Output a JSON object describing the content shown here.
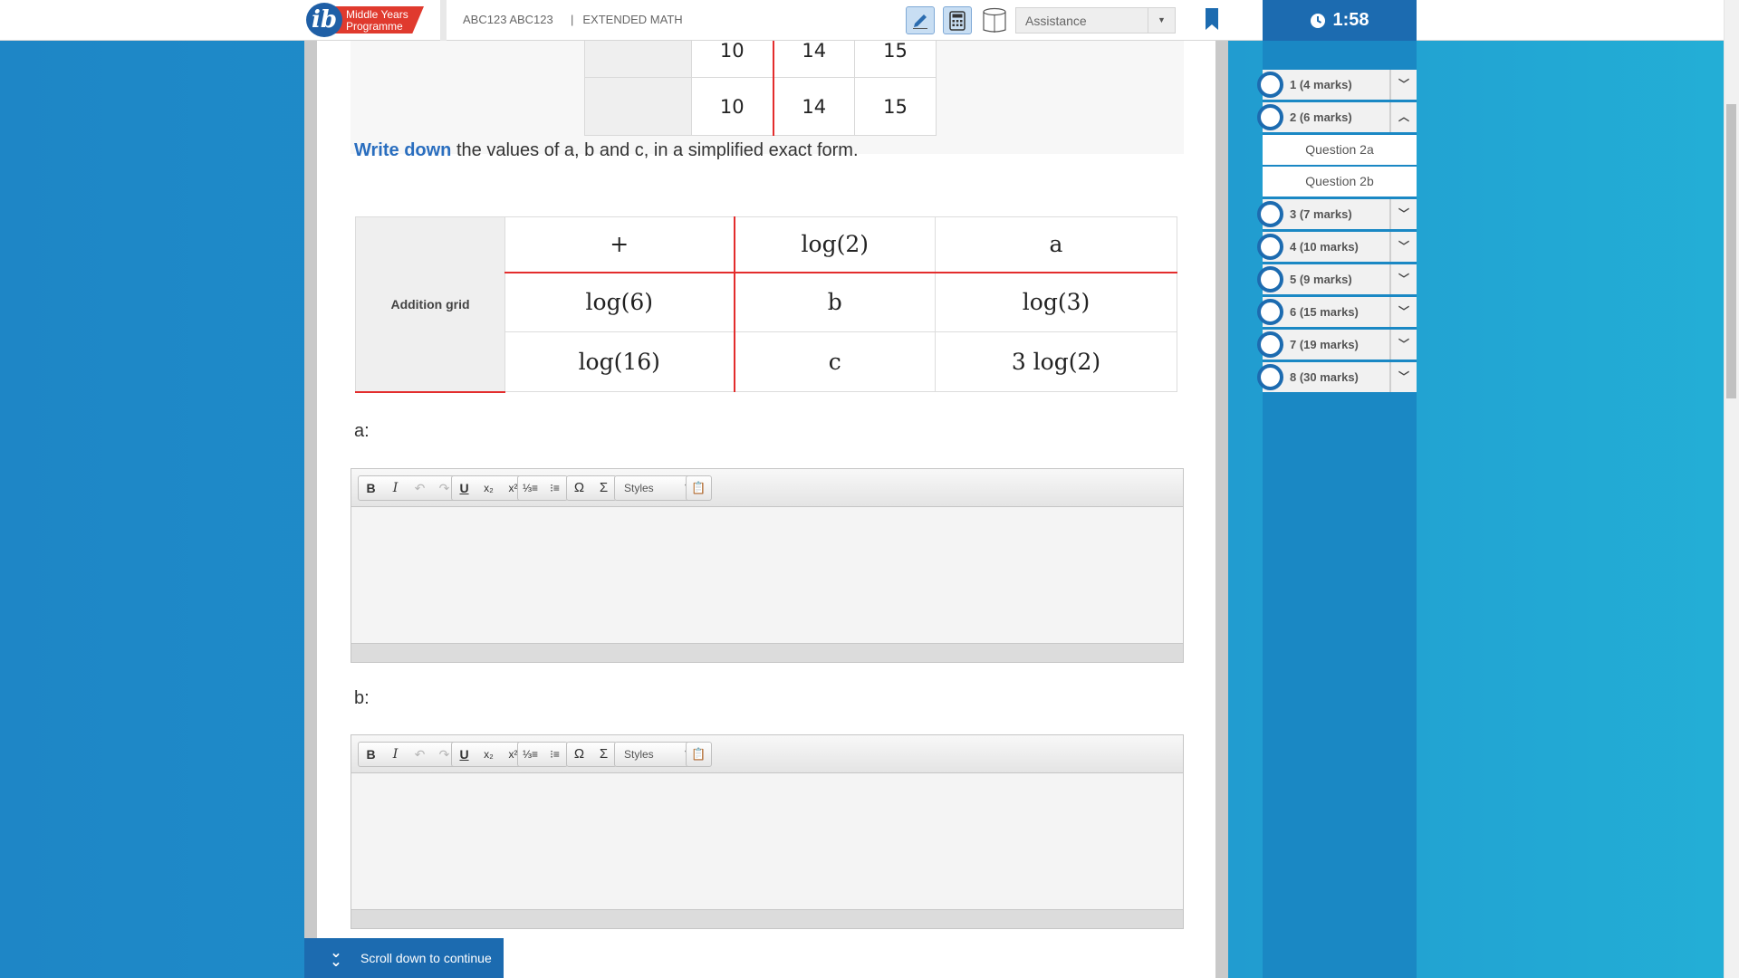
{
  "header": {
    "logo_line1": "Middle Years",
    "logo_line2": "Programme",
    "logo_letter": "ib",
    "candidate": "ABC123 ABC123",
    "separator": "|",
    "subject": "EXTENDED MATH",
    "assistance_label": "Assistance",
    "timer": "1:58",
    "icons": [
      "pen-icon",
      "calculator-icon",
      "resource-book-icon",
      "bookmark-icon",
      "clock-icon"
    ]
  },
  "previous_table": {
    "values": [
      "10",
      "14",
      "15"
    ]
  },
  "question": {
    "command_term": "Write down",
    "prompt": "the values of a, b and c, in a simplified exact form.",
    "grid_label": "Addition grid",
    "grid": [
      [
        "+",
        "log(2)",
        "a"
      ],
      [
        "log(6)",
        "b",
        "log(3)"
      ],
      [
        "log(16)",
        "c",
        "3 log(2)"
      ]
    ]
  },
  "answers": [
    {
      "label": "a:"
    },
    {
      "label": "b:"
    }
  ],
  "editor": {
    "styles_label": "Styles",
    "buttons": [
      "bold",
      "italic",
      "undo",
      "redo",
      "underline",
      "subscript",
      "superscript",
      "numbered-list",
      "bullet-list",
      "special-character",
      "math-symbol",
      "styles",
      "paste-from-word"
    ]
  },
  "scroll_prompt": "Scroll down to continue",
  "nav": {
    "questions": [
      {
        "label": "1 (4 marks)",
        "expanded": false
      },
      {
        "label": "2 (6 marks)",
        "expanded": true,
        "subs": [
          "Question 2a",
          "Question 2b"
        ]
      },
      {
        "label": "3 (7 marks)",
        "expanded": false
      },
      {
        "label": "4 (10 marks)",
        "expanded": false
      },
      {
        "label": "5 (9 marks)",
        "expanded": false
      },
      {
        "label": "6 (15 marks)",
        "expanded": false
      },
      {
        "label": "7 (19 marks)",
        "expanded": false
      },
      {
        "label": "8 (30 marks)",
        "expanded": false
      }
    ]
  },
  "colors": {
    "accent_blue": "#1c6bb0",
    "command_term": "#2a6ebf",
    "grid_red": "#e32d2d"
  }
}
